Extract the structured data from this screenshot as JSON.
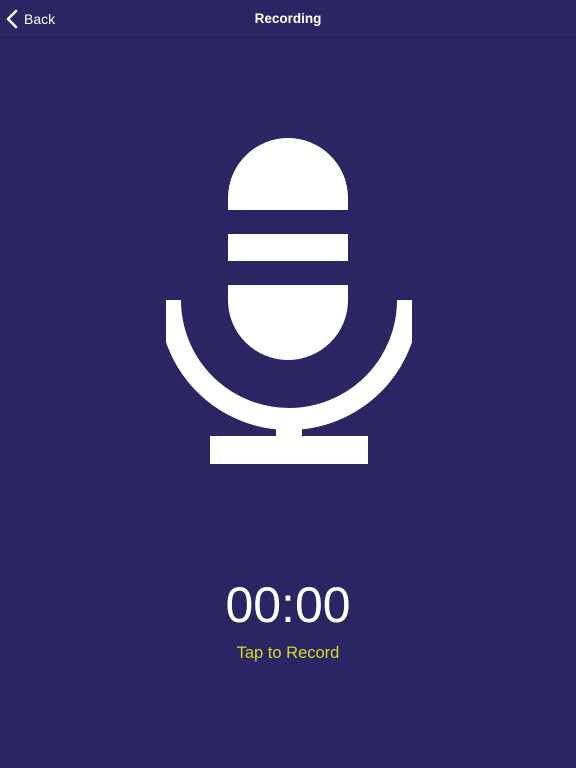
{
  "navbar": {
    "back_label": "Back",
    "back_icon": "chevron-left-icon",
    "title": "Recording"
  },
  "main": {
    "mic_icon": "microphone-icon",
    "timer": "00:00",
    "hint": "Tap to Record"
  },
  "colors": {
    "background": "#2b2563",
    "text": "#ffffff",
    "accent": "#d3d82c"
  }
}
